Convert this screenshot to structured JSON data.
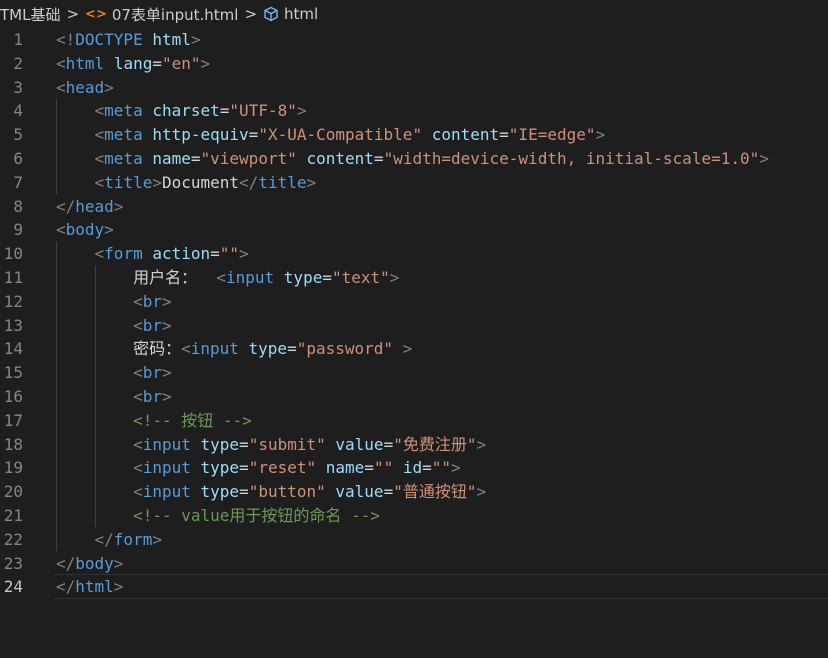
{
  "breadcrumb": {
    "folder": "TML基础",
    "file": "07表单input.html",
    "symbol": "html"
  },
  "editor": {
    "active_line": 24,
    "lines": [
      {
        "n": "1",
        "tokens": [
          [
            "t",
            "<!"
          ],
          [
            "tag",
            "DOCTYPE"
          ],
          [
            "txt",
            " "
          ],
          [
            "attr",
            "html"
          ],
          [
            "t",
            ">"
          ]
        ]
      },
      {
        "n": "2",
        "tokens": [
          [
            "t",
            "<"
          ],
          [
            "tag",
            "html"
          ],
          [
            "txt",
            " "
          ],
          [
            "attr",
            "lang"
          ],
          [
            "txt",
            "="
          ],
          [
            "str",
            "\"en\""
          ],
          [
            "t",
            ">"
          ]
        ]
      },
      {
        "n": "3",
        "tokens": [
          [
            "t",
            "<"
          ],
          [
            "tag",
            "head"
          ],
          [
            "t",
            ">"
          ]
        ]
      },
      {
        "n": "4",
        "tokens": [
          [
            "txt",
            "    "
          ],
          [
            "t",
            "<"
          ],
          [
            "tag",
            "meta"
          ],
          [
            "txt",
            " "
          ],
          [
            "attr",
            "charset"
          ],
          [
            "txt",
            "="
          ],
          [
            "str",
            "\"UTF-8\""
          ],
          [
            "t",
            ">"
          ]
        ]
      },
      {
        "n": "5",
        "tokens": [
          [
            "txt",
            "    "
          ],
          [
            "t",
            "<"
          ],
          [
            "tag",
            "meta"
          ],
          [
            "txt",
            " "
          ],
          [
            "attr",
            "http-equiv"
          ],
          [
            "txt",
            "="
          ],
          [
            "str",
            "\"X-UA-Compatible\""
          ],
          [
            "txt",
            " "
          ],
          [
            "attr",
            "content"
          ],
          [
            "txt",
            "="
          ],
          [
            "str",
            "\"IE=edge\""
          ],
          [
            "t",
            ">"
          ]
        ]
      },
      {
        "n": "6",
        "tokens": [
          [
            "txt",
            "    "
          ],
          [
            "t",
            "<"
          ],
          [
            "tag",
            "meta"
          ],
          [
            "txt",
            " "
          ],
          [
            "attr",
            "name"
          ],
          [
            "txt",
            "="
          ],
          [
            "str",
            "\"viewport\""
          ],
          [
            "txt",
            " "
          ],
          [
            "attr",
            "content"
          ],
          [
            "txt",
            "="
          ],
          [
            "str",
            "\"width=device-width, initial-scale=1.0\""
          ],
          [
            "t",
            ">"
          ]
        ]
      },
      {
        "n": "7",
        "tokens": [
          [
            "txt",
            "    "
          ],
          [
            "t",
            "<"
          ],
          [
            "tag",
            "title"
          ],
          [
            "t",
            ">"
          ],
          [
            "txt",
            "Document"
          ],
          [
            "t",
            "</"
          ],
          [
            "tag",
            "title"
          ],
          [
            "t",
            ">"
          ]
        ]
      },
      {
        "n": "8",
        "tokens": [
          [
            "t",
            "</"
          ],
          [
            "tag",
            "head"
          ],
          [
            "t",
            ">"
          ]
        ]
      },
      {
        "n": "9",
        "tokens": [
          [
            "t",
            "<"
          ],
          [
            "tag",
            "body"
          ],
          [
            "t",
            ">"
          ]
        ]
      },
      {
        "n": "10",
        "tokens": [
          [
            "txt",
            "    "
          ],
          [
            "t",
            "<"
          ],
          [
            "tag",
            "form"
          ],
          [
            "txt",
            " "
          ],
          [
            "attr",
            "action"
          ],
          [
            "txt",
            "="
          ],
          [
            "str",
            "\"\""
          ],
          [
            "t",
            ">"
          ]
        ]
      },
      {
        "n": "11",
        "tokens": [
          [
            "txt",
            "        用户名：  "
          ],
          [
            "t",
            "<"
          ],
          [
            "tag",
            "input"
          ],
          [
            "txt",
            " "
          ],
          [
            "attr",
            "type"
          ],
          [
            "txt",
            "="
          ],
          [
            "str",
            "\"text\""
          ],
          [
            "t",
            ">"
          ]
        ]
      },
      {
        "n": "12",
        "tokens": [
          [
            "txt",
            "        "
          ],
          [
            "t",
            "<"
          ],
          [
            "tag",
            "br"
          ],
          [
            "t",
            ">"
          ]
        ]
      },
      {
        "n": "13",
        "tokens": [
          [
            "txt",
            "        "
          ],
          [
            "t",
            "<"
          ],
          [
            "tag",
            "br"
          ],
          [
            "t",
            ">"
          ]
        ]
      },
      {
        "n": "14",
        "tokens": [
          [
            "txt",
            "        密码："
          ],
          [
            "t",
            "<"
          ],
          [
            "tag",
            "input"
          ],
          [
            "txt",
            " "
          ],
          [
            "attr",
            "type"
          ],
          [
            "txt",
            "="
          ],
          [
            "str",
            "\"password\""
          ],
          [
            "txt",
            " "
          ],
          [
            "t",
            ">"
          ]
        ]
      },
      {
        "n": "15",
        "tokens": [
          [
            "txt",
            "        "
          ],
          [
            "t",
            "<"
          ],
          [
            "tag",
            "br"
          ],
          [
            "t",
            ">"
          ]
        ]
      },
      {
        "n": "16",
        "tokens": [
          [
            "txt",
            "        "
          ],
          [
            "t",
            "<"
          ],
          [
            "tag",
            "br"
          ],
          [
            "t",
            ">"
          ]
        ]
      },
      {
        "n": "17",
        "tokens": [
          [
            "txt",
            "        "
          ],
          [
            "cmt",
            "<!-- 按钮 -->"
          ]
        ]
      },
      {
        "n": "18",
        "tokens": [
          [
            "txt",
            "        "
          ],
          [
            "t",
            "<"
          ],
          [
            "tag",
            "input"
          ],
          [
            "txt",
            " "
          ],
          [
            "attr",
            "type"
          ],
          [
            "txt",
            "="
          ],
          [
            "str",
            "\"submit\""
          ],
          [
            "txt",
            " "
          ],
          [
            "attr",
            "value"
          ],
          [
            "txt",
            "="
          ],
          [
            "str",
            "\"免费注册\""
          ],
          [
            "t",
            ">"
          ]
        ]
      },
      {
        "n": "19",
        "tokens": [
          [
            "txt",
            "        "
          ],
          [
            "t",
            "<"
          ],
          [
            "tag",
            "input"
          ],
          [
            "txt",
            " "
          ],
          [
            "attr",
            "type"
          ],
          [
            "txt",
            "="
          ],
          [
            "str",
            "\"reset\""
          ],
          [
            "txt",
            " "
          ],
          [
            "attr",
            "name"
          ],
          [
            "txt",
            "="
          ],
          [
            "str",
            "\"\""
          ],
          [
            "txt",
            " "
          ],
          [
            "attr",
            "id"
          ],
          [
            "txt",
            "="
          ],
          [
            "str",
            "\"\""
          ],
          [
            "t",
            ">"
          ]
        ]
      },
      {
        "n": "20",
        "tokens": [
          [
            "txt",
            "        "
          ],
          [
            "t",
            "<"
          ],
          [
            "tag",
            "input"
          ],
          [
            "txt",
            " "
          ],
          [
            "attr",
            "type"
          ],
          [
            "txt",
            "="
          ],
          [
            "str",
            "\"button\""
          ],
          [
            "txt",
            " "
          ],
          [
            "attr",
            "value"
          ],
          [
            "txt",
            "="
          ],
          [
            "str",
            "\"普通按钮\""
          ],
          [
            "t",
            ">"
          ]
        ]
      },
      {
        "n": "21",
        "tokens": [
          [
            "txt",
            "        "
          ],
          [
            "cmt",
            "<!-- value用于按钮的命名 -->"
          ]
        ]
      },
      {
        "n": "22",
        "tokens": [
          [
            "txt",
            "    "
          ],
          [
            "t",
            "</"
          ],
          [
            "tag",
            "form"
          ],
          [
            "t",
            ">"
          ]
        ]
      },
      {
        "n": "23",
        "tokens": [
          [
            "t",
            "</"
          ],
          [
            "tag",
            "body"
          ],
          [
            "t",
            ">"
          ]
        ]
      },
      {
        "n": "24",
        "tokens": [
          [
            "t",
            "</"
          ],
          [
            "tag",
            "html"
          ],
          [
            "t",
            ">"
          ]
        ]
      }
    ]
  }
}
